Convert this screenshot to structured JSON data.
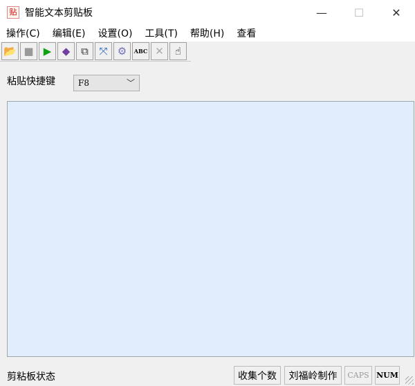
{
  "window": {
    "title": "智能文本剪贴板",
    "app_icon_glyph": "贴",
    "minimize": "—",
    "maximize": "☐",
    "close": "✕"
  },
  "menu": [
    "操作(C)",
    "编辑(E)",
    "设置(O)",
    "工具(T)",
    "帮助(H)",
    "查看"
  ],
  "toolbar": [
    {
      "name": "open-folder-icon",
      "glyph": "📂",
      "color": "#c89000"
    },
    {
      "name": "save-icon",
      "glyph": "■",
      "color": "#999999"
    },
    {
      "name": "play-icon",
      "glyph": "▶",
      "color": "#10a010"
    },
    {
      "name": "capture-icon",
      "glyph": "◆",
      "color": "#7040a0"
    },
    {
      "name": "copy-windows-icon",
      "glyph": "⧉",
      "color": "#333333"
    },
    {
      "name": "screen-icon",
      "glyph": "⤧",
      "color": "#2060c0"
    },
    {
      "name": "gear-icon",
      "glyph": "⚙",
      "color": "#7070c0"
    },
    {
      "name": "spellcheck-icon",
      "glyph": "ABC",
      "color": "#000000"
    },
    {
      "name": "delete-icon",
      "glyph": "✕",
      "color": "#aaaaaa"
    },
    {
      "name": "pointer-hand-icon",
      "glyph": "☝",
      "color": "#000000"
    }
  ],
  "hotkey": {
    "label": "粘贴快捷键",
    "value": "F8"
  },
  "status": {
    "left": "剪粘板状态",
    "count": "收集个数",
    "author": "刘福岭制作",
    "caps": "CAPS",
    "num": "NUM"
  }
}
